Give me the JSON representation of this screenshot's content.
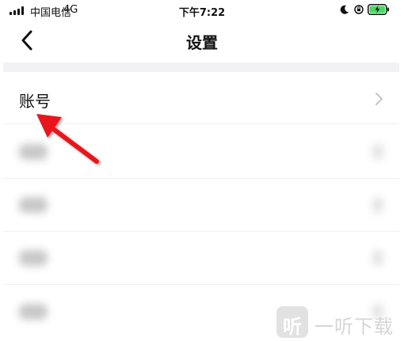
{
  "status_bar": {
    "carrier": "中国电信",
    "network": "4G",
    "time": "下午7:22"
  },
  "nav": {
    "title": "设置"
  },
  "settings": {
    "items": [
      {
        "label": "账号",
        "blurred": false
      },
      {
        "label": "",
        "blurred": true
      },
      {
        "label": "",
        "blurred": true
      },
      {
        "label": "",
        "blurred": true
      },
      {
        "label": "",
        "blurred": true
      }
    ]
  },
  "annotation": {
    "arrow_color": "#e8191c"
  },
  "watermark": {
    "badge_glyph": "听",
    "text": "一听下载"
  },
  "colors": {
    "band": "#f2f2f4",
    "battery_charging": "#4cd964"
  }
}
